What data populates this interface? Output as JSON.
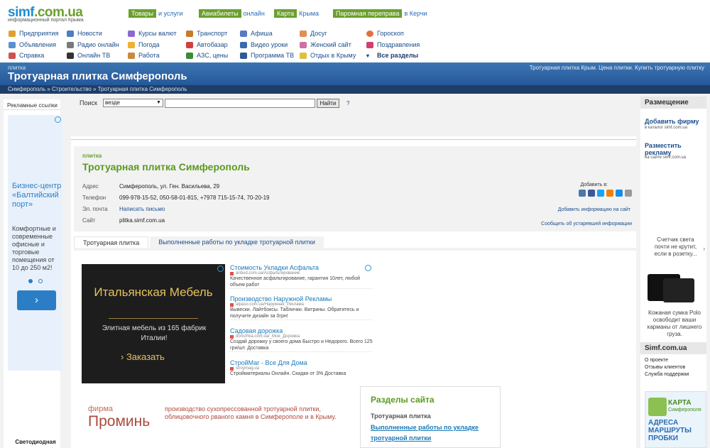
{
  "logo": {
    "part1": "simf",
    "part2": ".com.ua",
    "tagline": "информационный портал Крыма"
  },
  "promos": [
    {
      "tag": "Товары",
      "rest": "и услуги"
    },
    {
      "tag": "Авиабилеты",
      "rest": "онлайн"
    },
    {
      "tag": "Карта",
      "rest": "Крыма"
    },
    {
      "tag": "Паромная переправа",
      "rest": "в Керчи"
    }
  ],
  "nav": {
    "col1": [
      "Предприятия",
      "Объявления",
      "Справка"
    ],
    "col2": [
      "Новости",
      "Радио онлайн",
      "Онлайн ТВ"
    ],
    "col3": [
      "Курсы валют",
      "Погода",
      "Работа"
    ],
    "col4": [
      "Транспорт",
      "Автобазар",
      "АЗС, цены"
    ],
    "col5": [
      "Афиша",
      "Видео уроки",
      "Программа ТВ"
    ],
    "col6": [
      "Досуг",
      "Женский сайт",
      "Отдых в Крыму"
    ],
    "col7": [
      "Гороскоп",
      "Поздравления",
      "Все разделы"
    ]
  },
  "header_bar": {
    "category": "плитка",
    "title": "Тротуарная плитка Симферополь",
    "right": "Тротуарная плитка Крым. Цена плитки. Купить тротуарную плитку"
  },
  "breadcrumbs": [
    "Симферополь",
    "Строительство",
    "Тротуарная плитка Симферополь"
  ],
  "left_ads": {
    "title": "Рекламные ссылки",
    "headline": "Бизнес-центр «Балтийский порт»",
    "text": "Комфортные и современные офисные и торговые помещения от 10 до 250 м2!",
    "button": "›",
    "footer": "Светодиодная"
  },
  "search": {
    "label": "Поиск",
    "scope": "везде",
    "value": "",
    "button": "Найти",
    "help": "?"
  },
  "company": {
    "category": "плитка",
    "name": "Тротуарная плитка Симферополь",
    "address_label": "Адрес",
    "address": "Симферополь, ул. Ген. Васильева, 29",
    "phone_label": "Телефон",
    "phone": "099-978-15-52, 050-58-01-815, +7978 715-15-74, 70-20-19",
    "email_label": "Эл. почта",
    "email": "Написать письмо",
    "site_label": "Сайт",
    "site": "plitka.simf.com.ua",
    "add_to": "Добавить в:",
    "add_info": "Добавить информацию на сайт",
    "report": "Сообщить об устаревшей информации"
  },
  "tabs": [
    "Тротуарная плитка",
    "Выполненные работы по укладке тротуарной плитки"
  ],
  "main_ad": {
    "headline": "Итальянская Мебель",
    "sub": "Элитная мебель из 165 фабрик Италии!",
    "button": "› Заказать"
  },
  "ad_list": [
    {
      "title": "Стоимость Укладки Асфальта",
      "url": "anbud.com.ua/Асфальтирование",
      "desc": "Качественное асфальтирование, гарантия 10лет, любой объем работ"
    },
    {
      "title": "Производство Наружной Рекламы",
      "url": "alpaso.com.ua/Наружная_Реклама",
      "desc": "Вывески. Лайтбоксы. Таблички. Витрины. Обратитесь и получите дизайн за 0грн!"
    },
    {
      "title": "Садовая дорожка",
      "url": "dorozhka.com.ua/_Моя_Дорожка",
      "desc": "Создай дорожку у своего дома Быстро и Недорого. Всего 125 грн/шт. Доставка"
    },
    {
      "title": "СтройМаг - Все Для Дома",
      "url": "stroymag.ua",
      "desc": "Стройматериалы Онлайн. Скидки от 3% Доставка"
    }
  ],
  "firm": {
    "label": "фирма",
    "name": "Проминь",
    "desc": "производство сухопрессованной тротуарной плитки, облицовочного рваного камня в Симферополе и в Крыму."
  },
  "sections": {
    "title": "Разделы сайта",
    "current": "Тротуарная плитка",
    "link": "Выполненные работы по укладке тротуарной плитки"
  },
  "right": {
    "placement_title": "Размещение",
    "link1": "Добавить фирму",
    "link1_sub": "в каталог simf.com.ua",
    "link2": "Разместить рекламу",
    "link2_sub": "на сайте simf.com.ua",
    "ad1": "Счетчик света почти не крутит, если в розетку...",
    "ad1_more": "›",
    "ad2": "Кожаная сумка Polo освободит ваши карманы от лишнего груза.",
    "site_title": "Simf.com.ua",
    "site_links": [
      "О проекте",
      "Отзывы клиентов",
      "Служба поддержки"
    ],
    "map_word": "КАРТА",
    "map_city": "Симферополя",
    "map_text": "АДРЕСА МАРШРУТЫ ПРОБКИ"
  },
  "colors": {
    "accent_green": "#6aa02c",
    "header_blue": "#2f68a8",
    "link_blue": "#1a4e8c"
  }
}
